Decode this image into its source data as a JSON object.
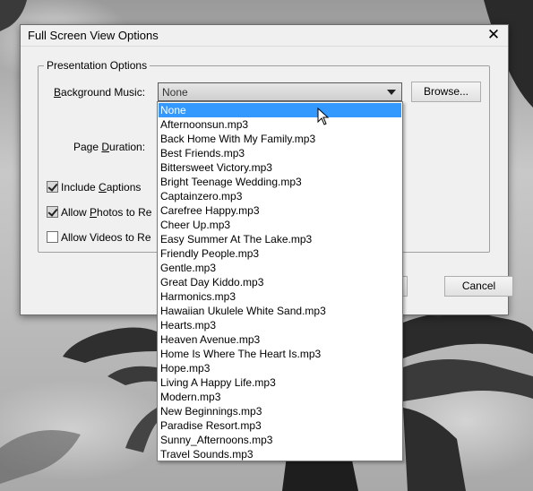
{
  "dialog": {
    "title": "Full Screen View Options",
    "close_glyph": "✕",
    "group_label": "Presentation Options",
    "background_music_label": "Background Music:",
    "background_music_value": "None",
    "browse_label": "Browse...",
    "page_duration_label": "Page Duration:",
    "include_captions_label": "Include Captions",
    "include_captions_checked": true,
    "allow_photos_label": "Allow Photos to Re",
    "allow_photos_checked": true,
    "allow_videos_label": "Allow Videos to Re",
    "allow_videos_checked": false,
    "cancel_label": "Cancel"
  },
  "dropdown": {
    "selected_index": 0,
    "options": [
      "None",
      "Afternoonsun.mp3",
      "Back Home With My Family.mp3",
      "Best Friends.mp3",
      "Bittersweet Victory.mp3",
      "Bright Teenage Wedding.mp3",
      "Captainzero.mp3",
      "Carefree Happy.mp3",
      "Cheer Up.mp3",
      "Easy Summer At The Lake.mp3",
      "Friendly People.mp3",
      "Gentle.mp3",
      "Great Day Kiddo.mp3",
      "Harmonics.mp3",
      "Hawaiian Ukulele White Sand.mp3",
      "Hearts.mp3",
      "Heaven Avenue.mp3",
      "Home Is Where The Heart Is.mp3",
      "Hope.mp3",
      "Living A Happy Life.mp3",
      "Modern.mp3",
      "New Beginnings.mp3",
      "Paradise Resort.mp3",
      "Sunny_Afternoons.mp3",
      "Travel Sounds.mp3"
    ]
  },
  "colors": {
    "selection": "#3399ff",
    "dialog_bg": "#f0f0f0"
  },
  "icons": {
    "close": "close-icon",
    "dropdown_arrow": "chevron-down-icon",
    "cursor": "mouse-pointer-icon"
  }
}
